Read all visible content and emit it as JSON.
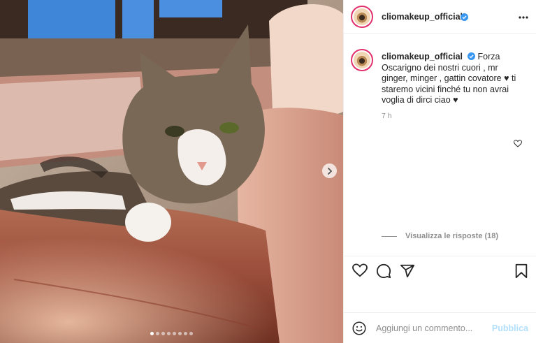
{
  "post": {
    "username": "cliomakeup_official",
    "verified": true,
    "image_icon": "cat-photo",
    "carousel": {
      "total": 8,
      "active_index": 0
    }
  },
  "caption": {
    "username": "cliomakeup_official",
    "text": "Forza Oscarigno dei nostri cuori , mr ginger, minger , gattin covatore ♥ ti staremo vicini finché tu non avrai voglia di dirci ciao ♥",
    "time": "7 h"
  },
  "replies": {
    "label": "Visualizza le risposte (18)"
  },
  "actions": {
    "like_icon": "heart-icon",
    "comment_icon": "comment-icon",
    "share_icon": "share-icon",
    "save_icon": "bookmark-icon"
  },
  "comment_box": {
    "placeholder": "Aggiungi un commento...",
    "publish_label": "Pubblica"
  },
  "colors": {
    "accent_blue": "#0095f6",
    "publish_disabled": "#b2dffc",
    "border": "#efefef",
    "secondary_text": "#8e8e8e"
  }
}
